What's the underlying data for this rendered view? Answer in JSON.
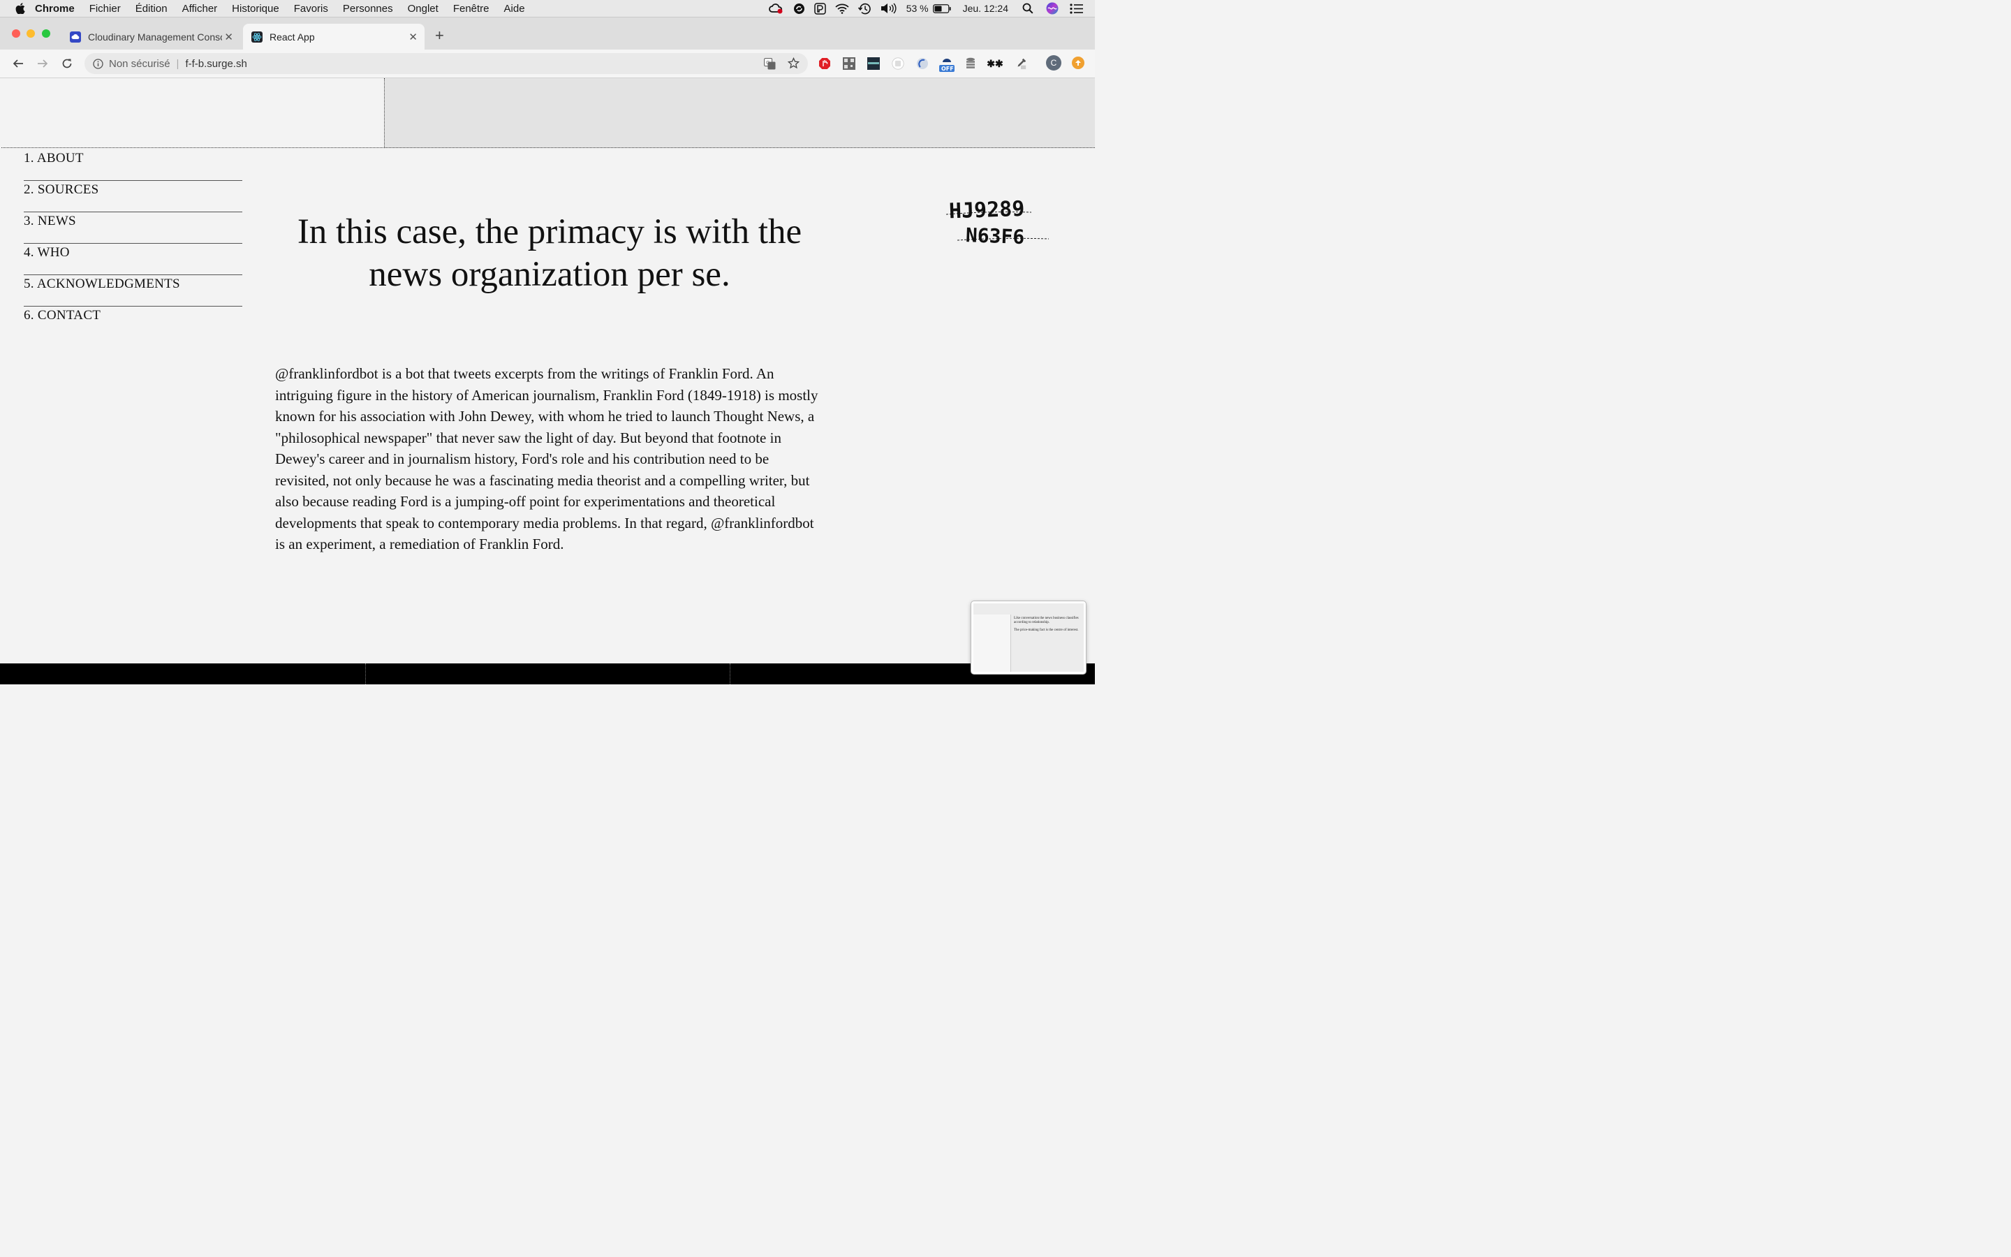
{
  "menubar": {
    "app": "Chrome",
    "items": [
      "Fichier",
      "Édition",
      "Afficher",
      "Historique",
      "Favoris",
      "Personnes",
      "Onglet",
      "Fenêtre",
      "Aide"
    ],
    "battery": "53 %",
    "clock": "Jeu. 12:24"
  },
  "tabs": [
    {
      "title": "Cloudinary Management Conso",
      "active": false
    },
    {
      "title": "React App",
      "active": true
    }
  ],
  "address": {
    "security": "Non sécurisé",
    "url": "f-f-b.surge.sh"
  },
  "extensions": {
    "off_badge": "OFF",
    "profile_initial": "C"
  },
  "nav": {
    "items": [
      "1. ABOUT",
      "2. SOURCES",
      "3. NEWS",
      "4. WHO",
      "5. ACKNOWLEDGMENTS",
      "6. CONTACT"
    ]
  },
  "headline": "In this case, the primacy is with the news organization per se.",
  "body": "@franklinfordbot is a bot that tweets excerpts from the writings of Franklin Ford. An intriguing figure in the history of American journalism, Franklin Ford (1849-1918) is mostly known for his association with John Dewey, with whom he tried to launch Thought News, a \"philosophical newspaper\" that never saw the light of day. But beyond that footnote in Dewey's career and in journalism history, Ford's role and his contribution need to be revisited, not only because he was a fascinating media theorist and a compelling writer, but also because reading Ford is a jumping-off point for experimentations and theoretical developments that speak to contemporary media problems. In that regard, @franklinfordbot is an experiment, a remediation of Franklin Ford.",
  "stamp": {
    "line1": "HJ9289",
    "line2": "N63F6"
  },
  "thumbnail": {
    "line1": "Like conversation the news business classifies according to relationship.",
    "line2": "The price-making fact is the centre of interest."
  },
  "colors": {
    "close_red": "#fe5f57",
    "minimize_yellow": "#febc2e",
    "zoom_green": "#28c840",
    "page_bg": "#f3f3f3"
  }
}
